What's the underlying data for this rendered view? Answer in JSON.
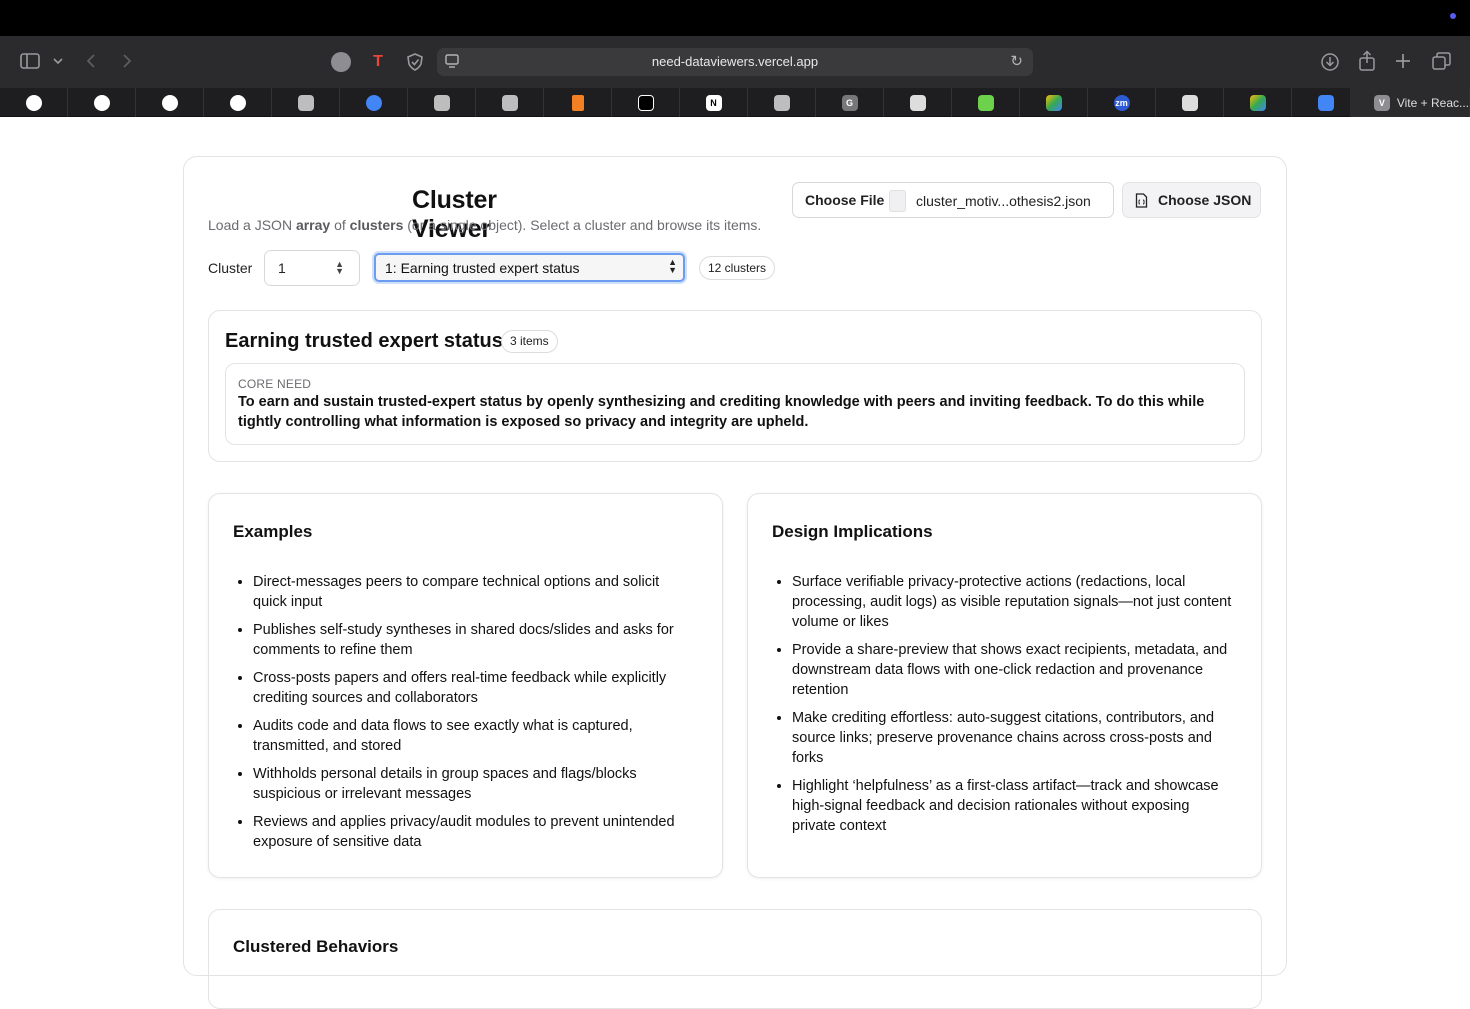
{
  "browser": {
    "url": "need-dataviewers.vercel.app",
    "active_tab_label": "Vite + Reac...",
    "active_tab_initial": "V"
  },
  "app": {
    "title": "Cluster Viewer",
    "subtitle_pre": "Load a JSON ",
    "subtitle_bold1": "array",
    "subtitle_mid": " of ",
    "subtitle_bold2": "clusters",
    "subtitle_post": " (or a single object). Select a cluster and browse its items.",
    "file_input": {
      "button_label": "Choose File",
      "file_name": "cluster_motiv...othesis2.json"
    },
    "choose_json_label": "Choose JSON",
    "controls": {
      "cluster_label": "Cluster",
      "cluster_number": "1",
      "selected_cluster": "1: Earning trusted expert status",
      "cluster_count": "12 clusters"
    },
    "summary": {
      "heading": "Earning trusted expert status",
      "item_count": "3 items",
      "core_need_key": "CORE NEED",
      "core_need_text": "To earn and sustain trusted-expert status by openly synthesizing and crediting knowledge with peers and inviting feedback. To do this while tightly controlling what information is exposed so privacy and integrity are upheld."
    },
    "examples": {
      "heading": "Examples",
      "items": [
        "Direct-messages peers to compare technical options and solicit quick input",
        "Publishes self-study syntheses in shared docs/slides and asks for comments to refine them",
        "Cross-posts papers and offers real-time feedback while explicitly crediting sources and collaborators",
        "Audits code and data flows to see exactly what is captured, transmitted, and stored",
        "Withholds personal details in group spaces and flags/blocks suspicious or irrelevant messages",
        "Reviews and applies privacy/audit modules to prevent unintended exposure of sensitive data"
      ]
    },
    "design_implications": {
      "heading": "Design Implications",
      "items": [
        "Surface verifiable privacy-protective actions (redactions, local processing, audit logs) as visible reputation signals—not just content volume or likes",
        "Provide a share-preview that shows exact recipients, metadata, and downstream data flows with one-click redaction and provenance retention",
        "Make crediting effortless: auto-suggest citations, contributors, and source links; preserve provenance chains across cross-posts and forks",
        "Highlight ‘helpfulness’ as a first-class artifact—track and showcase high-signal feedback and decision rationales without exposing private context"
      ]
    },
    "clustered_behaviors_heading": "Clustered Behaviors"
  },
  "colors": {
    "accent_focus": "#6b9cf0",
    "border": "#e3e3e6",
    "muted_text": "#6b6b70"
  }
}
